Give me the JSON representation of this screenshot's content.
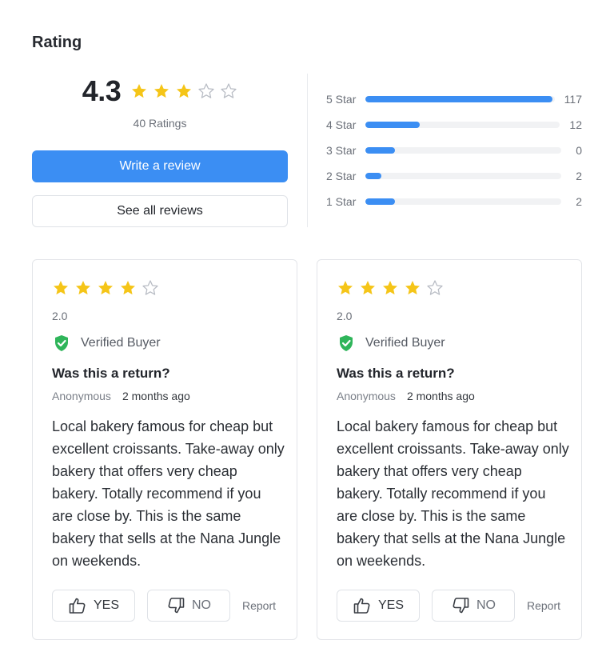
{
  "section_title": "Rating",
  "summary": {
    "score": "4.3",
    "stars_filled": 3,
    "stars_total": 5,
    "ratings_count": "40 Ratings",
    "write_review_label": "Write a review",
    "see_all_label": "See all reviews"
  },
  "distribution": [
    {
      "label": "5 Star",
      "value": "117",
      "fraction": 0.99
    },
    {
      "label": "4 Star",
      "value": "12",
      "fraction": 0.28
    },
    {
      "label": "3 Star",
      "value": "0",
      "fraction": 0.15
    },
    {
      "label": "2 Star",
      "value": "2",
      "fraction": 0.08
    },
    {
      "label": "1 Star",
      "value": "2",
      "fraction": 0.15
    }
  ],
  "reviews": [
    {
      "stars_filled": 4,
      "rating": "2.0",
      "verified_label": "Verified Buyer",
      "title": "Was this a return?",
      "author": "Anonymous",
      "time": "2 months ago",
      "body": "Local bakery famous for cheap but excellent croissants. Take-away only bakery that offers very cheap bakery. Totally recommend if you are close by. This is the same bakery that sells at the Nana Jungle on weekends.",
      "yes_label": "YES",
      "no_label": "NO",
      "report_label": "Report"
    },
    {
      "stars_filled": 4,
      "rating": "2.0",
      "verified_label": "Verified Buyer",
      "title": "Was this a return?",
      "author": "Anonymous",
      "time": "2 months ago",
      "body": "Local bakery famous for cheap but excellent croissants. Take-away only bakery that offers very cheap bakery. Totally recommend if you are close by. This is the same bakery that sells at the Nana Jungle on weekends.",
      "yes_label": "YES",
      "no_label": "NO",
      "report_label": "Report"
    }
  ],
  "colors": {
    "accent": "#3b8ef3",
    "star": "#f5c518",
    "star_empty": "#b8bcc4",
    "verified": "#2fb55a"
  }
}
